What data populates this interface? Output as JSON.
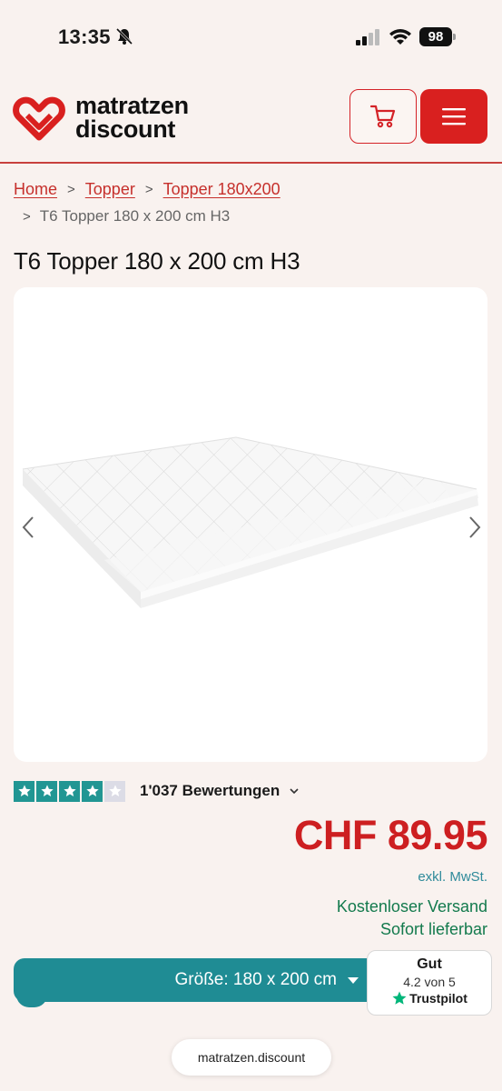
{
  "status": {
    "time": "13:35",
    "battery": "98"
  },
  "header": {
    "logo_line1": "matratzen",
    "logo_line2": "discount",
    "brand_color": "#d9201f"
  },
  "breadcrumb": {
    "items": [
      "Home",
      "Topper",
      "Topper 180x200"
    ],
    "current": "T6 Topper 180 x 200 cm H3",
    "separator": ">"
  },
  "product": {
    "title": "T6 Topper 180 x 200 cm H3",
    "rating_stars": 4,
    "rating_max": 5,
    "reviews": "1'037 Bewertungen",
    "price": "CHF 89.95",
    "vat_note": "exkl. MwSt.",
    "shipping": "Kostenloser Versand",
    "availability": "Sofort lieferbar",
    "size_label": "Größe: 180 x 200 cm"
  },
  "trustpilot": {
    "title": "Gut",
    "score": "4.2 von 5",
    "brand": "Trustpilot",
    "color": "#00b67a"
  },
  "browser": {
    "url": "matratzen.discount"
  }
}
